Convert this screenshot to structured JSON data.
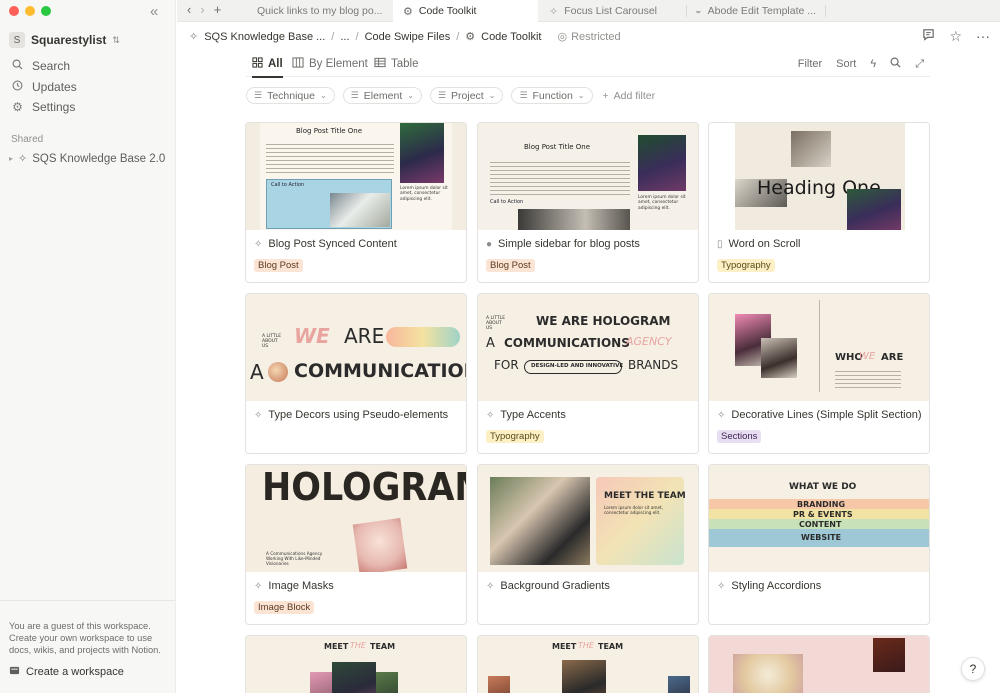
{
  "window": {
    "traffic_colors": [
      "#ff5f57",
      "#febc2e",
      "#28c840"
    ]
  },
  "sidebar": {
    "workspace_initial": "S",
    "workspace_name": "Squarestylist",
    "nav": [
      {
        "icon": "search-icon",
        "label": "Search"
      },
      {
        "icon": "updates-icon",
        "label": "Updates"
      },
      {
        "icon": "settings-icon",
        "label": "Settings"
      }
    ],
    "shared_label": "Shared",
    "shared_item": "SQS Knowledge Base 2.0",
    "guest_text": "You are a guest of this workspace. Create your own workspace to use docs, wikis, and projects with Notion.",
    "create_label": "Create a workspace"
  },
  "tabs": [
    {
      "label": "Quick links to my blog po...",
      "active": false
    },
    {
      "label": "Code Toolkit",
      "active": true
    },
    {
      "label": "Focus List Carousel",
      "active": false
    },
    {
      "label": "Abode Edit Template ...",
      "active": false
    }
  ],
  "breadcrumb": {
    "root": "SQS Knowledge Base ...",
    "ellipsis": "...",
    "parent": "Code Swipe Files",
    "current": "Code Toolkit",
    "restricted": "Restricted"
  },
  "views": {
    "all": "All",
    "by_element": "By Element",
    "table": "Table",
    "filter": "Filter",
    "sort": "Sort"
  },
  "filters": [
    "Technique",
    "Element",
    "Project",
    "Function"
  ],
  "add_filter": "Add filter",
  "cards": [
    {
      "title": "Blog Post Synced Content",
      "icon": "sparkle-icon",
      "tag": "Blog Post",
      "tag_bg": "#fbe4d4",
      "tag_fg": "#5c3b23"
    },
    {
      "title": "Simple sidebar for blog posts",
      "icon": "chat-icon",
      "tag": "Blog Post",
      "tag_bg": "#fbe4d4",
      "tag_fg": "#5c3b23"
    },
    {
      "title": "Word on Scroll",
      "icon": "page-icon",
      "tag": "Typography",
      "tag_bg": "#fdf0c6",
      "tag_fg": "#5a4a16"
    },
    {
      "title": "Type Decors using Pseudo-elements",
      "icon": "sparkle-icon",
      "tag": "",
      "tag_bg": "",
      "tag_fg": ""
    },
    {
      "title": "Type Accents",
      "icon": "sparkle-icon",
      "tag": "Typography",
      "tag_bg": "#fdf0c6",
      "tag_fg": "#5a4a16"
    },
    {
      "title": "Decorative Lines (Simple Split Section)",
      "icon": "sparkle-icon",
      "tag": "Sections",
      "tag_bg": "#e8def2",
      "tag_fg": "#412454"
    },
    {
      "title": "Image Masks",
      "icon": "sparkle-icon",
      "tag": "Image Block",
      "tag_bg": "#fbe4d4",
      "tag_fg": "#5c3b23"
    },
    {
      "title": "Background Gradients",
      "icon": "sparkle-icon",
      "tag": "",
      "tag_bg": "",
      "tag_fg": ""
    },
    {
      "title": "Styling Accordions",
      "icon": "sparkle-icon",
      "tag": "",
      "tag_bg": "",
      "tag_fg": ""
    }
  ],
  "covers": {
    "c1_title": "Blog Post Title One",
    "c1_cta": "Call to Action",
    "c1_side": "Lorem ipsum dolor sit amet, consectetur adipiscing elit.",
    "c2_title": "Blog Post Title One",
    "c2_cta": "Call to Action",
    "c2_side": "Lorem ipsum dolor sit amet, consectetur adipiscing elit.",
    "c3_heading": "Heading One",
    "c4_small": "A LITTLE ABOUT US",
    "c4_we": "WE",
    "c4_are": "ARE",
    "c4_a": "A",
    "c4_comm": "COMMUNICATIONS",
    "c5_small": "A LITTLE ABOUT US",
    "c5_line1": "WE ARE HOLOGRAM",
    "c5_a": "A",
    "c5_comm": "COMMUNICATIONS",
    "c5_agency": "AGENCY",
    "c5_for": "FOR",
    "c5_pill": "DESIGN-LED AND INNOVATIVE",
    "c5_brands": "BRANDS",
    "c6_who": "WHO",
    "c6_we": "WE",
    "c6_are": "ARE",
    "c7_title": "HOLOGRAM",
    "c7_sub": "A Communications Agency Working With Like-Minded Visionaries",
    "c8_meet": "MEET THE TEAM",
    "c8_sub": "Lorem ipsum dolor sit amet, consectetur adipiscing elit.",
    "c9_what": "WHAT WE DO",
    "c9_items": [
      "BRANDING",
      "PR & EVENTS",
      "CONTENT",
      "WEBSITE"
    ],
    "c10_meet": "MEET",
    "c10_the": "THE",
    "c10_team": "TEAM",
    "c11_meet": "MEET",
    "c11_the": "THE",
    "c11_team": "TEAM"
  },
  "help": "?"
}
